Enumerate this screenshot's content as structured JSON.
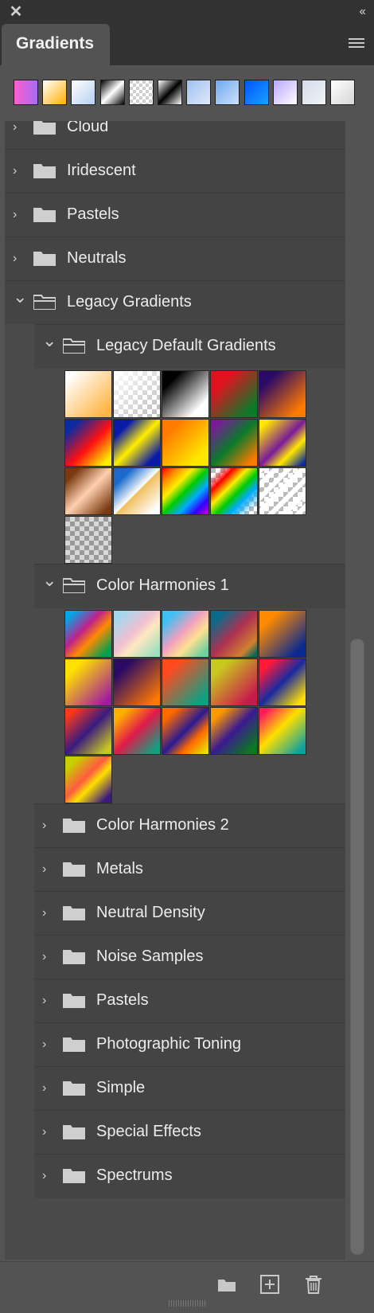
{
  "panel": {
    "title": "Gradients"
  },
  "top_swatches": [
    "linear-gradient(90deg,#ff5ecf,#a46bf0)",
    "linear-gradient(135deg,#ffffff,#ffb000)",
    "linear-gradient(135deg,#ffffff,#b7d0f0)",
    "linear-gradient(135deg,#000000,#ffffff,#000000)",
    "repeating-conic-gradient(#fff 0 25%,#cfcfcf 0 50%) 0 0/8px 8px",
    "linear-gradient(135deg,#ffffff,#000000,#ffffff)",
    "linear-gradient(135deg,#9fc0f0,#dfe9fb)",
    "linear-gradient(135deg,#6ea8f0,#cfe1fb)",
    "linear-gradient(135deg,#0054ff,#1aa1ff)",
    "linear-gradient(135deg,#b9a6ff,#ffffff)",
    "linear-gradient(135deg,#d4dce8,#f0f3f7)",
    "linear-gradient(135deg,#ffffff,#d6d6d6)"
  ],
  "folders_top": [
    "Cloud",
    "Iridescent",
    "Pastels",
    "Neutrals"
  ],
  "legacy_folder": "Legacy Gradients",
  "legacy_default": {
    "label": "Legacy Default Gradients",
    "cells": [
      "linear-gradient(135deg,#ffffff 10%,#ffb340 90%)",
      "linear-gradient(135deg,#ffffff,rgba(255,255,255,0)), repeating-conic-gradient(#fff 0 25%,#bbb 0 50%) 0 0/12px 12px",
      "linear-gradient(135deg,#000 20%,#fff 80%)",
      "linear-gradient(135deg,#e0121e 25%,#0a7a2a 85%)",
      "linear-gradient(135deg,#2a0a66 20%,#ff7a00 85%)",
      "linear-gradient(135deg,#0a2aa0 15%,#ff1010 55%,#ffee00 90%)",
      "linear-gradient(135deg,#0a1aa8 20%,#ffee00 50%,#0a1aa8 85%)",
      "linear-gradient(135deg,#ff7a00 20%,#ffe600 80%)",
      "linear-gradient(135deg,#7a1a9a 10%,#0a7a2a 50%,#ff7a00 90%)",
      "linear-gradient(135deg,#ffe800 10%,#7a1a9a 50%,#ffe800 70%,#0a2aa0 95%)",
      "linear-gradient(135deg,#7a3a10 15%,#ffd0b0 50%,#7a3a10 90%)",
      "linear-gradient(135deg,#1a6acc 20%,#ffffff 50%,#f0c060 52%,#fff 90%)",
      "linear-gradient(135deg,#ff0000,#ff8a00,#ffee00,#00cc00,#00aaff,#3300ff,#cc00cc)",
      "linear-gradient(135deg,rgba(255,255,255,0) 10%,#ff0000 25%,#ffee00 40%,#00cc00 55%,#00aaff 70%,rgba(255,255,255,0) 90%), repeating-conic-gradient(#fff 0 25%,#bbb 0 50%) 0 0/12px 12px",
      "repeating-linear-gradient(135deg,#ffffff 0 6px,rgba(255,255,255,0) 6px 12px), repeating-conic-gradient(#fff 0 25%,#bbb 0 50%) 0 0/12px 12px",
      "repeating-conic-gradient(#d8d8d8 0 25%,#9a9a9a 0 50%) 0 0/12px 12px"
    ]
  },
  "color_harmonies_1": {
    "label": "Color Harmonies 1",
    "cells": [
      "linear-gradient(135deg,#00a8e8 10%,#c0208a 40%,#ff8a00 60%,#00a050 90%)",
      "linear-gradient(135deg,#a0d8f0 10%,#f0c0d0 45%,#ffe8c0 60%,#a0e0c0 90%)",
      "linear-gradient(135deg,#40c0f0 15%,#f0a0c0 45%,#ffe090 65%,#70d0a0 90%)",
      "linear-gradient(135deg,#0a6a8a 15%,#b03050 50%,#d08030 80%,#0a6a5a 95%)",
      "linear-gradient(135deg,#ff8a00 20%,#0a2a90 85%)",
      "linear-gradient(135deg,#ffe000 20%,#a01aa0 90%)",
      "linear-gradient(135deg,#2a0a66 20%,#ff7a00 90%)",
      "linear-gradient(135deg,#ff4a20 20%,#10a080 85%)",
      "linear-gradient(135deg,#c8c820 20%,#c81a4a 85%)",
      "linear-gradient(135deg,#ff1a3a 15%,#1a2aa0 50%,#ffe000 90%)",
      "linear-gradient(135deg,#ff3a1a 10%,#3a1a80 50%,#c8c820 90%)",
      "linear-gradient(135deg,#ffb000 15%,#e01a4a 50%,#10a080 90%)",
      "linear-gradient(135deg,#ff6a00 15%,#2a1a90 50%,#ff6a00 70%,#e8e000 95%)",
      "linear-gradient(135deg,#ff9a00 15%,#3a1a90 50%,#0a7a20 90%)",
      "linear-gradient(135deg,#ff1a5a 10%,#ffe000 45%,#10a0a0 90%)",
      "linear-gradient(135deg,#c8d000 15%,#ff5a40 45%,#ffe000 60%,#3a1a80 90%)"
    ]
  },
  "legacy_subfolders": [
    "Color Harmonies 2",
    "Metals",
    "Neutral Density",
    "Noise Samples",
    "Pastels",
    "Photographic Toning",
    "Simple",
    "Special Effects",
    "Spectrums"
  ]
}
